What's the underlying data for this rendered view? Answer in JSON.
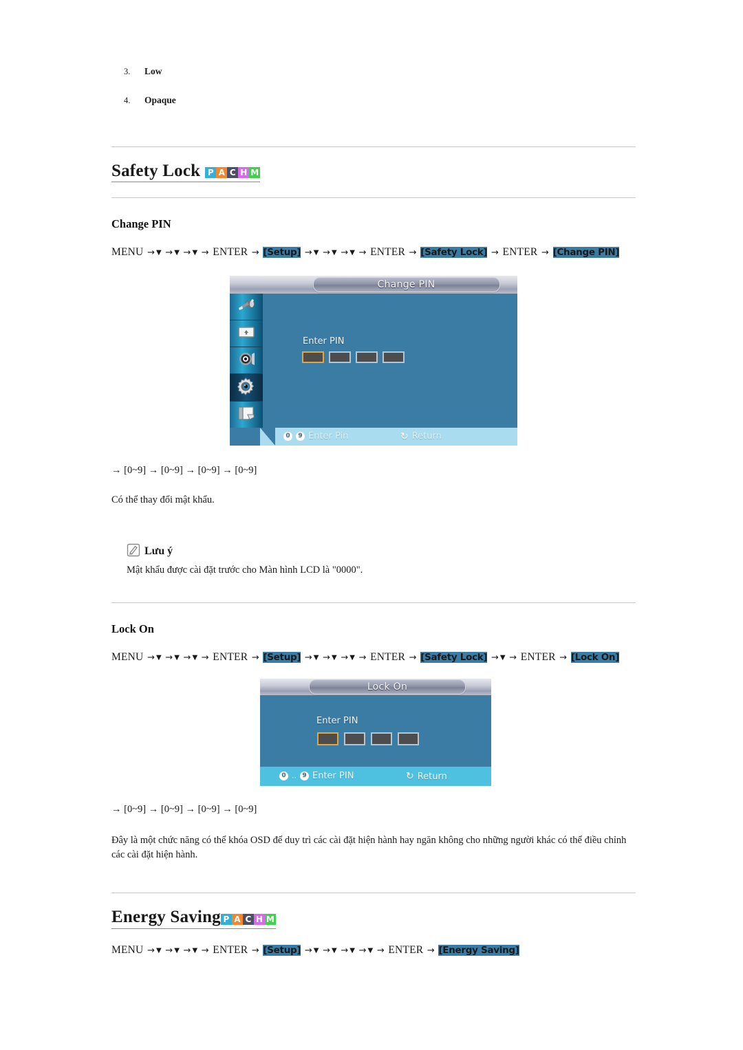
{
  "top_list": {
    "items": [
      {
        "num": "3.",
        "label": "Low"
      },
      {
        "num": "4.",
        "label": "Opaque"
      }
    ]
  },
  "badge": {
    "letters": [
      "P",
      "A",
      "C",
      "H",
      "M"
    ],
    "colors": [
      "#33b0da",
      "#f4872c",
      "#4d5064",
      "#d968ec",
      "#3fd14d"
    ]
  },
  "sections": {
    "safety_lock": {
      "heading": "Safety Lock",
      "change_pin": {
        "sub_heading": "Change PIN",
        "path": {
          "menu": "MENU",
          "enter": "ENTER",
          "setup": "[Setup]",
          "safety_lock": "[Safety Lock]",
          "target": "[Change PIN]",
          "down_before_enter": 3,
          "down_after_setup": 3,
          "down_after_safety_lock": 0
        },
        "osd": {
          "title": "Change PIN",
          "enter_label": "Enter PIN",
          "pin_boxes": 4,
          "active_box_index": 0,
          "footer_keys": "0..9",
          "footer_action": "Enter Pin",
          "footer_return": "Return",
          "rail_icons": [
            "picture-icon",
            "screen-icon",
            "sound-icon",
            "setup-gear-icon",
            "multicontrol-icon"
          ],
          "active_rail_index": 3
        },
        "range_line": "→ [0~9] → [0~9] → [0~9] → [0~9]",
        "description": "Có thể thay đổi mật khẩu."
      },
      "note": {
        "icon": "note-pencil-icon",
        "title": "Lưu ý",
        "body": "Mật khẩu được cài đặt trước cho Màn hình LCD là \"0000\"."
      },
      "lock_on": {
        "sub_heading": "Lock On",
        "path": {
          "menu": "MENU",
          "enter": "ENTER",
          "setup": "[Setup]",
          "safety_lock": "[Safety Lock]",
          "target": "[Lock On]",
          "down_before_enter": 3,
          "down_after_setup": 3,
          "down_after_safety_lock": 1
        },
        "osd": {
          "title": "Lock On",
          "enter_label": "Enter PIN",
          "pin_boxes": 4,
          "active_box_index": 0,
          "footer_keys": "0..9",
          "footer_action": "Enter PIN",
          "footer_return": "Return"
        },
        "range_line": "→ [0~9] → [0~9] → [0~9] → [0~9]",
        "description": "Đây là một chức năng có thể khóa OSD để duy trì các cài đặt hiện hành hay ngăn không cho những người khác có thể điều chỉnh các cài đặt hiện hành."
      }
    },
    "energy_saving": {
      "heading": "Energy Saving",
      "path": {
        "menu": "MENU",
        "enter": "ENTER",
        "setup": "[Setup]",
        "target": "[Energy Saving]",
        "down_before_enter": 3,
        "down_after_setup": 4
      }
    }
  }
}
